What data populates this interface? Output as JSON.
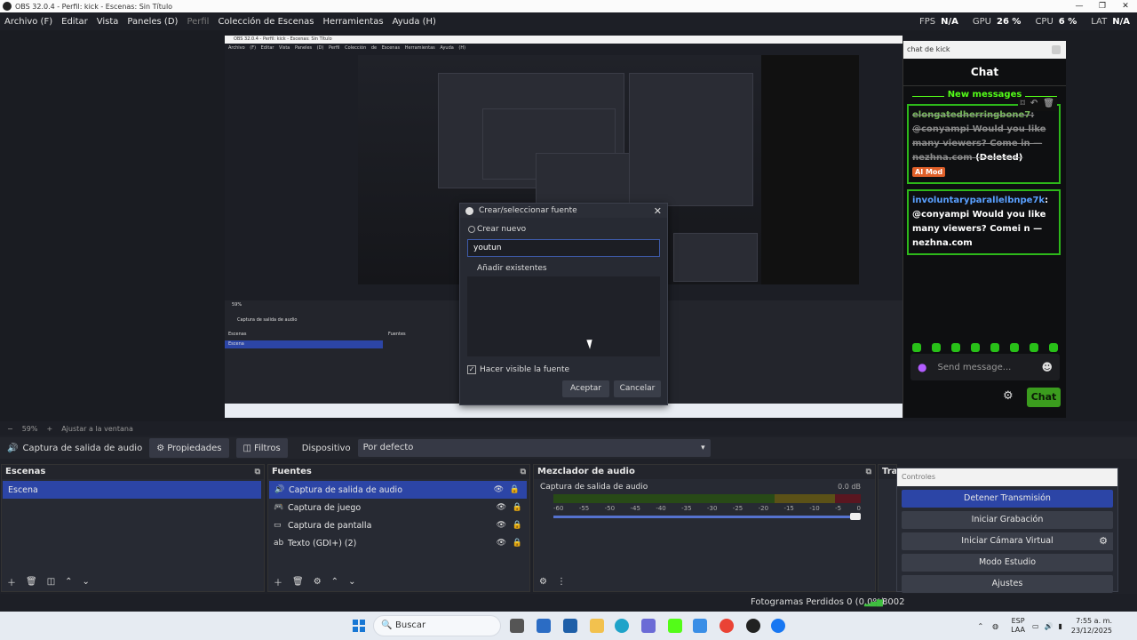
{
  "window": {
    "title": "OBS 32.0.4 - Perfil: kick - Escenas: Sin Título"
  },
  "menu": [
    "Archivo (F)",
    "Editar",
    "Vista",
    "Paneles (D)",
    "Perfil",
    "Colección de Escenas",
    "Herramientas",
    "Ayuda (H)"
  ],
  "stats": {
    "fps_label": "FPS",
    "fps": "N/A",
    "gpu_label": "GPU",
    "gpu": "26 %",
    "cpu_label": "CPU",
    "cpu": "6 %",
    "lat_label": "LAT",
    "lat": "N/A"
  },
  "nested": {
    "title": "OBS 32.0.4 - Perfil: kick - Escenas: Sin Título",
    "menu": "Archivo (F) Editar Vista Paneles (D) Perfil Colección de Escenas Herramientas Ayuda (H)",
    "zoom": "59%",
    "fit": "Ajustar a la ventana",
    "source": "Captura de salida de audio",
    "scene": "Escena",
    "fuentes": "Fuentes",
    "escenas": "Escenas"
  },
  "chat": {
    "window_title": "chat de kick",
    "title": "Chat",
    "new_messages": "New messages",
    "messages": [
      {
        "user": "elongatedherringbone7",
        "text": "@conyampi Would you like many viewers? Come in — nezhna.com",
        "deleted_label": "(Deleted)",
        "mod_label": "AI Mod"
      },
      {
        "user": "involuntaryparallelbnpe7k",
        "text": "@conyampi Would you like many viewers? Comei n — nezhna.com"
      }
    ],
    "placeholder": "Send message...",
    "chat_button": "Chat"
  },
  "dialog": {
    "title": "Crear/seleccionar fuente",
    "create_new": "Crear nuevo",
    "name_value": "youtun",
    "add_existing": "Añadir existentes",
    "visible_label": "Hacer visible la fuente",
    "ok": "Aceptar",
    "cancel": "Cancelar"
  },
  "zoombar": {
    "zoom": "59%",
    "fit": "Ajustar a la ventana"
  },
  "sourcebar": {
    "source": "Captura de salida de audio",
    "props": "Propiedades",
    "filters": "Filtros",
    "device_label": "Dispositivo",
    "device_value": "Por defecto"
  },
  "scenes": {
    "title": "Escenas",
    "items": [
      "Escena"
    ]
  },
  "sources": {
    "title": "Fuentes",
    "items": [
      "Captura de salida de audio",
      "Captura de juego",
      "Captura de pantalla",
      "Texto (GDI+) (2)"
    ]
  },
  "mixer": {
    "title": "Mezclador de audio",
    "channel": "Captura de salida de audio",
    "db": "0.0 dB",
    "ticks": [
      "-60",
      "-55",
      "-50",
      "-45",
      "-40",
      "-35",
      "-30",
      "-25",
      "-20",
      "-15",
      "-10",
      "-5",
      "0"
    ]
  },
  "transitions": {
    "title": "Tra"
  },
  "controls": {
    "title": "Controles",
    "buttons": [
      "Detener Transmisión",
      "Iniciar Grabación",
      "Iniciar Cámara Virtual",
      "Modo Estudio",
      "Ajustes"
    ]
  },
  "status": {
    "frames_dropped": "Fotogramas Perdidos 0 (0.0%)",
    "bitrate": "8002"
  },
  "taskbar": {
    "search": "Buscar",
    "lang1": "ESP",
    "lang2": "LAA",
    "time": "7:55 a. m.",
    "date": "23/12/2025"
  }
}
